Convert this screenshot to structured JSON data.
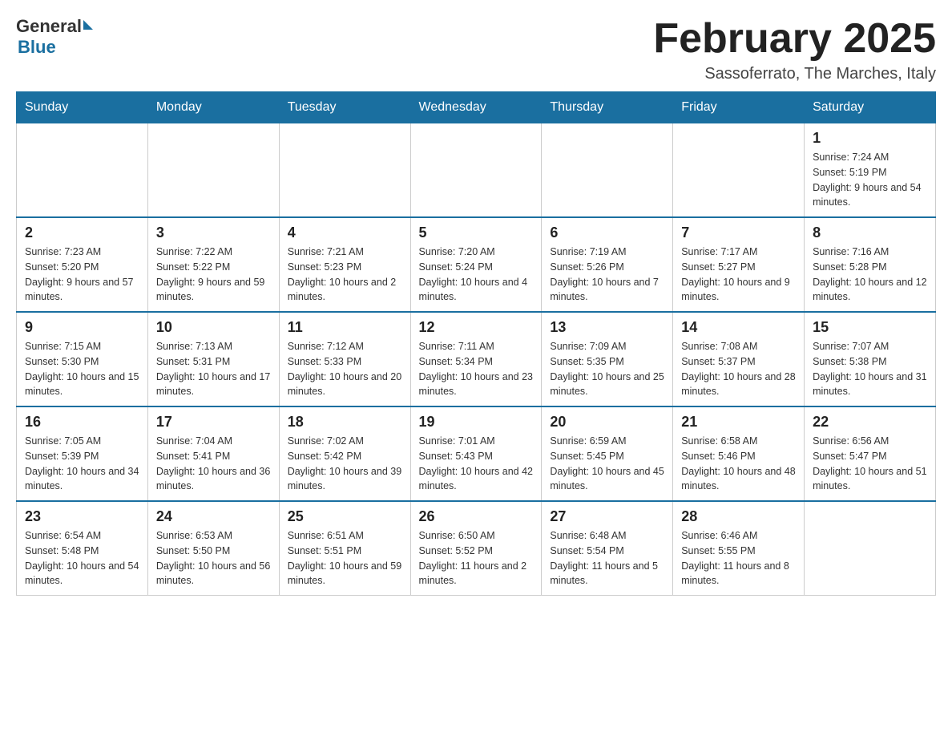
{
  "header": {
    "logo_general": "General",
    "logo_blue": "Blue",
    "title": "February 2025",
    "subtitle": "Sassoferrato, The Marches, Italy"
  },
  "days_of_week": [
    "Sunday",
    "Monday",
    "Tuesday",
    "Wednesday",
    "Thursday",
    "Friday",
    "Saturday"
  ],
  "weeks": [
    [
      {
        "day": "",
        "info": ""
      },
      {
        "day": "",
        "info": ""
      },
      {
        "day": "",
        "info": ""
      },
      {
        "day": "",
        "info": ""
      },
      {
        "day": "",
        "info": ""
      },
      {
        "day": "",
        "info": ""
      },
      {
        "day": "1",
        "info": "Sunrise: 7:24 AM\nSunset: 5:19 PM\nDaylight: 9 hours and 54 minutes."
      }
    ],
    [
      {
        "day": "2",
        "info": "Sunrise: 7:23 AM\nSunset: 5:20 PM\nDaylight: 9 hours and 57 minutes."
      },
      {
        "day": "3",
        "info": "Sunrise: 7:22 AM\nSunset: 5:22 PM\nDaylight: 9 hours and 59 minutes."
      },
      {
        "day": "4",
        "info": "Sunrise: 7:21 AM\nSunset: 5:23 PM\nDaylight: 10 hours and 2 minutes."
      },
      {
        "day": "5",
        "info": "Sunrise: 7:20 AM\nSunset: 5:24 PM\nDaylight: 10 hours and 4 minutes."
      },
      {
        "day": "6",
        "info": "Sunrise: 7:19 AM\nSunset: 5:26 PM\nDaylight: 10 hours and 7 minutes."
      },
      {
        "day": "7",
        "info": "Sunrise: 7:17 AM\nSunset: 5:27 PM\nDaylight: 10 hours and 9 minutes."
      },
      {
        "day": "8",
        "info": "Sunrise: 7:16 AM\nSunset: 5:28 PM\nDaylight: 10 hours and 12 minutes."
      }
    ],
    [
      {
        "day": "9",
        "info": "Sunrise: 7:15 AM\nSunset: 5:30 PM\nDaylight: 10 hours and 15 minutes."
      },
      {
        "day": "10",
        "info": "Sunrise: 7:13 AM\nSunset: 5:31 PM\nDaylight: 10 hours and 17 minutes."
      },
      {
        "day": "11",
        "info": "Sunrise: 7:12 AM\nSunset: 5:33 PM\nDaylight: 10 hours and 20 minutes."
      },
      {
        "day": "12",
        "info": "Sunrise: 7:11 AM\nSunset: 5:34 PM\nDaylight: 10 hours and 23 minutes."
      },
      {
        "day": "13",
        "info": "Sunrise: 7:09 AM\nSunset: 5:35 PM\nDaylight: 10 hours and 25 minutes."
      },
      {
        "day": "14",
        "info": "Sunrise: 7:08 AM\nSunset: 5:37 PM\nDaylight: 10 hours and 28 minutes."
      },
      {
        "day": "15",
        "info": "Sunrise: 7:07 AM\nSunset: 5:38 PM\nDaylight: 10 hours and 31 minutes."
      }
    ],
    [
      {
        "day": "16",
        "info": "Sunrise: 7:05 AM\nSunset: 5:39 PM\nDaylight: 10 hours and 34 minutes."
      },
      {
        "day": "17",
        "info": "Sunrise: 7:04 AM\nSunset: 5:41 PM\nDaylight: 10 hours and 36 minutes."
      },
      {
        "day": "18",
        "info": "Sunrise: 7:02 AM\nSunset: 5:42 PM\nDaylight: 10 hours and 39 minutes."
      },
      {
        "day": "19",
        "info": "Sunrise: 7:01 AM\nSunset: 5:43 PM\nDaylight: 10 hours and 42 minutes."
      },
      {
        "day": "20",
        "info": "Sunrise: 6:59 AM\nSunset: 5:45 PM\nDaylight: 10 hours and 45 minutes."
      },
      {
        "day": "21",
        "info": "Sunrise: 6:58 AM\nSunset: 5:46 PM\nDaylight: 10 hours and 48 minutes."
      },
      {
        "day": "22",
        "info": "Sunrise: 6:56 AM\nSunset: 5:47 PM\nDaylight: 10 hours and 51 minutes."
      }
    ],
    [
      {
        "day": "23",
        "info": "Sunrise: 6:54 AM\nSunset: 5:48 PM\nDaylight: 10 hours and 54 minutes."
      },
      {
        "day": "24",
        "info": "Sunrise: 6:53 AM\nSunset: 5:50 PM\nDaylight: 10 hours and 56 minutes."
      },
      {
        "day": "25",
        "info": "Sunrise: 6:51 AM\nSunset: 5:51 PM\nDaylight: 10 hours and 59 minutes."
      },
      {
        "day": "26",
        "info": "Sunrise: 6:50 AM\nSunset: 5:52 PM\nDaylight: 11 hours and 2 minutes."
      },
      {
        "day": "27",
        "info": "Sunrise: 6:48 AM\nSunset: 5:54 PM\nDaylight: 11 hours and 5 minutes."
      },
      {
        "day": "28",
        "info": "Sunrise: 6:46 AM\nSunset: 5:55 PM\nDaylight: 11 hours and 8 minutes."
      },
      {
        "day": "",
        "info": ""
      }
    ]
  ]
}
